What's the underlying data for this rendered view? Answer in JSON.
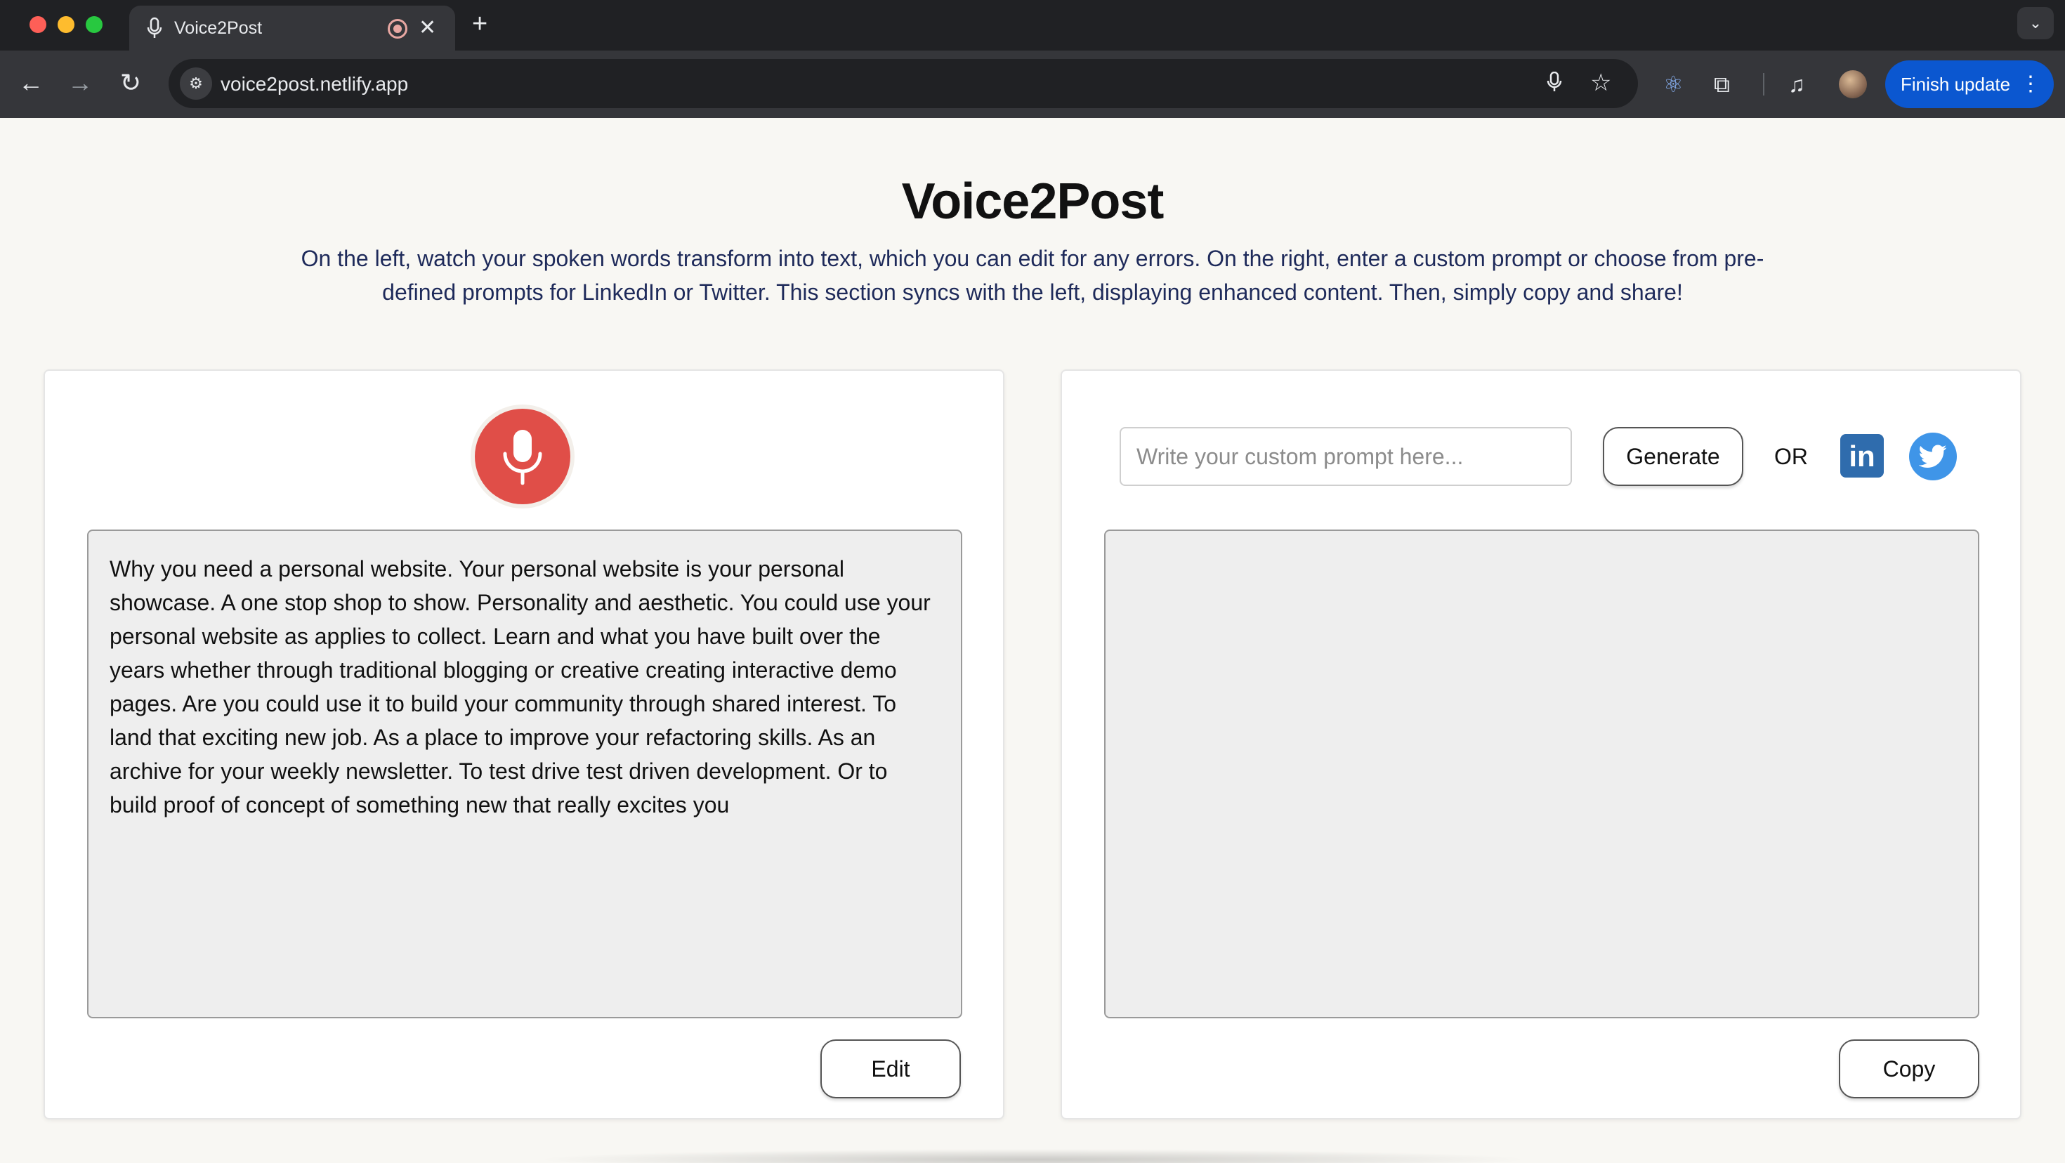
{
  "browser": {
    "tab_title": "Voice2Post",
    "new_tab": "+",
    "tab_close": "✕",
    "url": "voice2post.netlify.app",
    "finish_update_label": "Finish update"
  },
  "page": {
    "title": "Voice2Post",
    "description": "On the left, watch your spoken words transform into text, which you can edit for any errors. On the right, enter a custom prompt or choose from pre-defined prompts for LinkedIn or Twitter. This section syncs with the left, displaying enhanced content. Then, simply copy and share!"
  },
  "left_panel": {
    "mic_icon": "microphone-icon",
    "transcript": "Why you need a personal website. Your personal website is your personal showcase. A one stop shop to show. Personality and aesthetic. You could use your personal website as applies to collect. Learn and what you have built over the years whether through traditional blogging or creative creating interactive demo pages. Are you could use it to build your community through shared interest. To land that exciting new job. As a place to improve your refactoring skills. As an archive for your weekly newsletter. To test drive test driven development. Or to build proof of concept of something new that really excites you",
    "edit_label": "Edit"
  },
  "right_panel": {
    "prompt_placeholder": "Write your custom prompt here...",
    "prompt_value": "",
    "generate_label": "Generate",
    "or_label": "OR",
    "linkedin_label": "in",
    "output": "",
    "copy_label": "Copy"
  },
  "colors": {
    "mic_red": "#e04e48",
    "linkedin_blue": "#2f6cad",
    "twitter_blue": "#3f95e8",
    "finish_update_blue": "#0b57d0"
  }
}
